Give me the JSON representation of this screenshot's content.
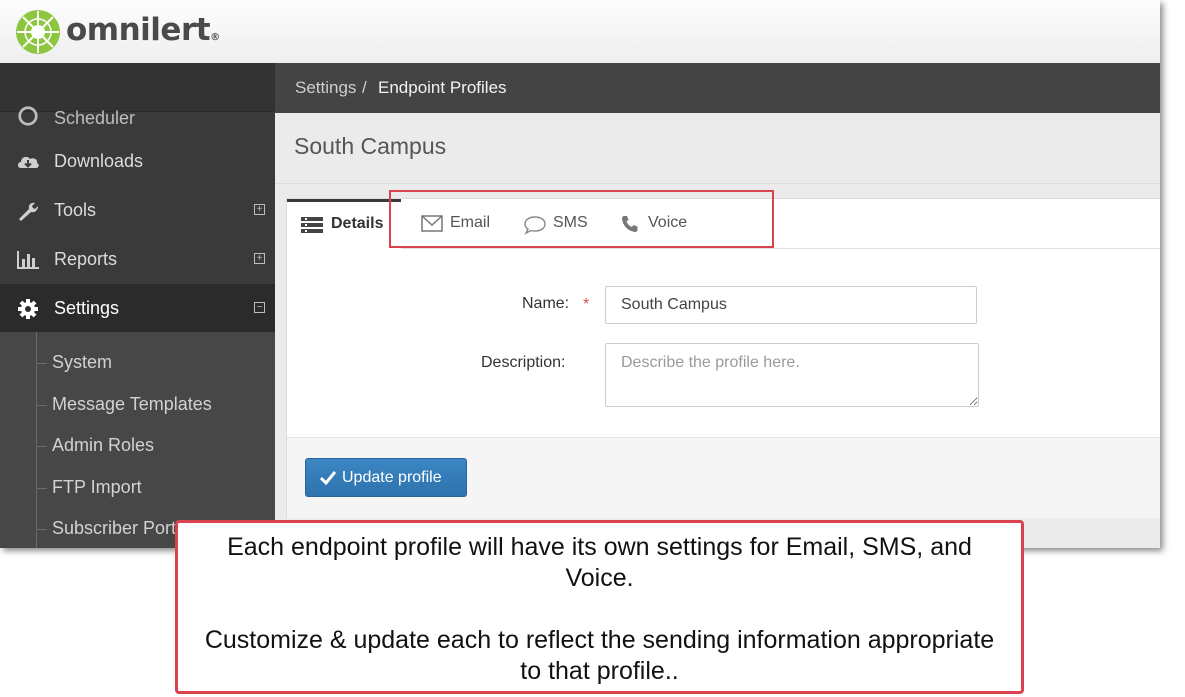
{
  "brand": {
    "name": "omnilert",
    "registered": "®",
    "logo_color": "#8dc63f"
  },
  "sidebar": {
    "items": [
      {
        "label": "Scheduler",
        "icon": "clock-icon"
      },
      {
        "label": "Downloads",
        "icon": "cloud-download-icon"
      },
      {
        "label": "Tools",
        "icon": "wrench-icon",
        "toggle": "⊞"
      },
      {
        "label": "Reports",
        "icon": "bar-chart-icon",
        "toggle": "⊞"
      },
      {
        "label": "Settings",
        "icon": "gear-icon",
        "toggle": "⊟",
        "active": true
      }
    ],
    "subitems": [
      {
        "label": "System"
      },
      {
        "label": "Message Templates"
      },
      {
        "label": "Admin Roles"
      },
      {
        "label": "FTP Import"
      },
      {
        "label": "Subscriber Portal"
      }
    ]
  },
  "breadcrumb": {
    "parent": "Settings",
    "separator": "/",
    "current": "Endpoint Profiles"
  },
  "page": {
    "title": "South Campus"
  },
  "tabs": [
    {
      "label": "Details",
      "icon": "list-icon",
      "active": true
    },
    {
      "label": "Email",
      "icon": "envelope-icon"
    },
    {
      "label": "SMS",
      "icon": "speech-bubble-icon"
    },
    {
      "label": "Voice",
      "icon": "phone-icon"
    }
  ],
  "form": {
    "name_label": "Name:",
    "required_marker": "*",
    "name_value": "South Campus",
    "description_label": "Description:",
    "description_placeholder": "Describe the profile here.",
    "submit_label": "Update profile"
  },
  "callout": {
    "line1": "Each endpoint profile will have its own settings for Email, SMS, and Voice.",
    "line2": "Customize & update each to reflect the sending information appropriate to that profile.."
  },
  "colors": {
    "accent": "#337ab7",
    "annotation": "#d9424e",
    "sidebar": "#3a3a3a"
  }
}
